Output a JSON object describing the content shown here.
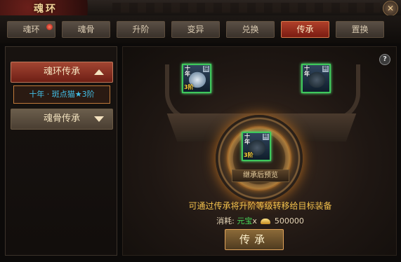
{
  "window": {
    "title": "魂环"
  },
  "tabs": [
    {
      "label": "魂环",
      "active": false,
      "badge": true
    },
    {
      "label": "魂骨",
      "active": false
    },
    {
      "label": "升阶",
      "active": false
    },
    {
      "label": "变异",
      "active": false
    },
    {
      "label": "兑换",
      "active": false
    },
    {
      "label": "传承",
      "active": true
    },
    {
      "label": "置换",
      "active": false
    }
  ],
  "sidebar": {
    "ring_inherit_label": "魂环传承",
    "selected_item": "十年 · 斑点猫★3阶",
    "bone_inherit_label": "魂骨传承"
  },
  "items": {
    "source": {
      "year": "十年",
      "tier": "3阶",
      "corner": "猫",
      "icon": "spotted-cat-icon"
    },
    "target": {
      "year": "十年",
      "tier": "",
      "corner": "熊",
      "icon": "bear-icon"
    },
    "result": {
      "year": "十年",
      "tier": "3阶",
      "corner": "熊",
      "icon": "bear-icon"
    }
  },
  "preview_label": "继承后预览",
  "description": "可通过传承将升阶等级转移给目标装备",
  "cost": {
    "label": "消耗:",
    "currency": "元宝",
    "multiplier": "x",
    "amount": "500000"
  },
  "action_button": "传承",
  "help_glyph": "?",
  "colors": {
    "accent_red": "#a24532",
    "gold_text": "#f4c24d",
    "green_currency": "#48d858",
    "item_border": "#3ec85c"
  }
}
